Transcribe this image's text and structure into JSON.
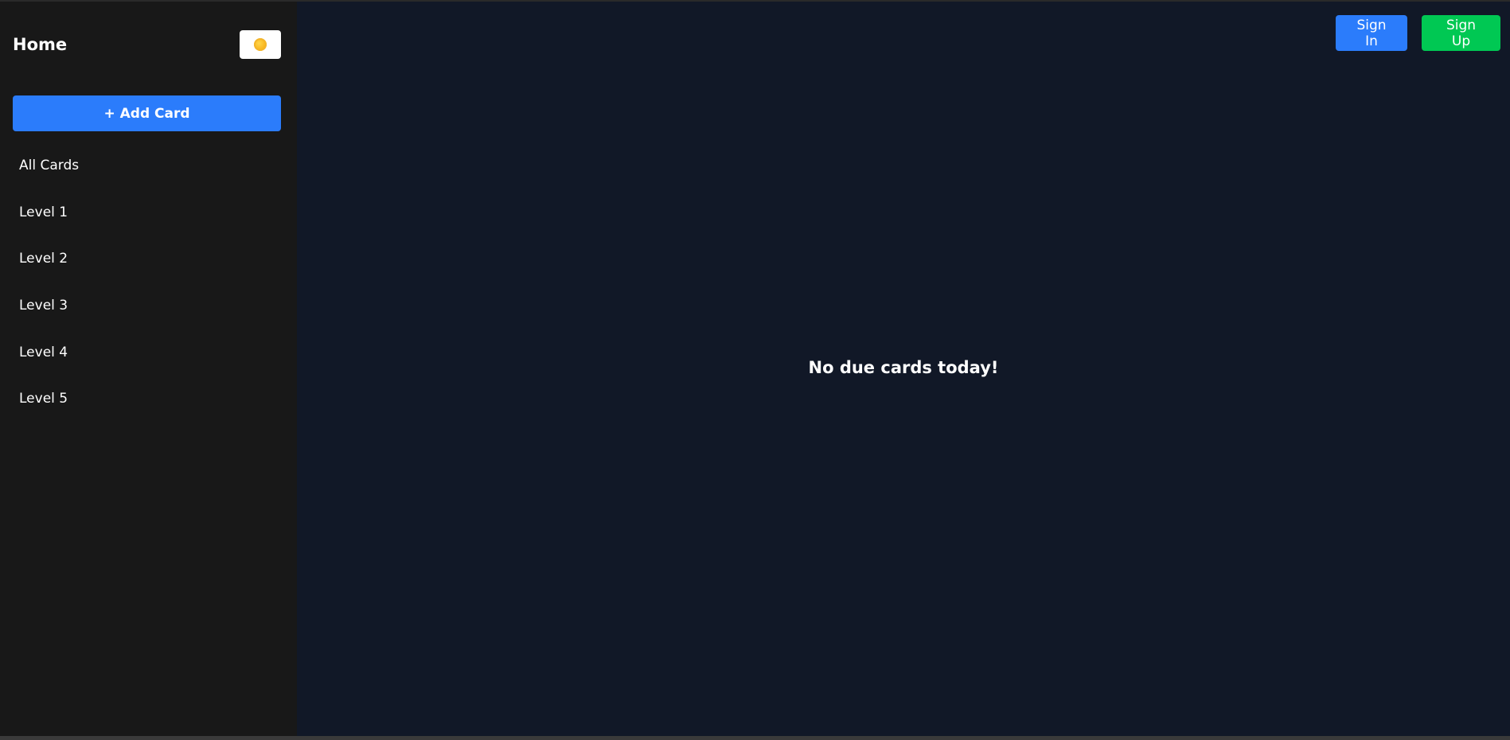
{
  "sidebar": {
    "title": "Home",
    "theme_toggle_icon": "sun-icon",
    "add_card_label": "+ Add Card",
    "items": [
      {
        "label": "All Cards"
      },
      {
        "label": "Level 1"
      },
      {
        "label": "Level 2"
      },
      {
        "label": "Level 3"
      },
      {
        "label": "Level 4"
      },
      {
        "label": "Level 5"
      }
    ]
  },
  "header": {
    "sign_in_label": "Sign In",
    "sign_up_label": "Sign Up"
  },
  "main": {
    "empty_message": "No due cards today!"
  },
  "colors": {
    "sidebar_bg": "#181818",
    "main_bg": "#111827",
    "primary": "#2b7cfb",
    "success": "#00c853"
  }
}
